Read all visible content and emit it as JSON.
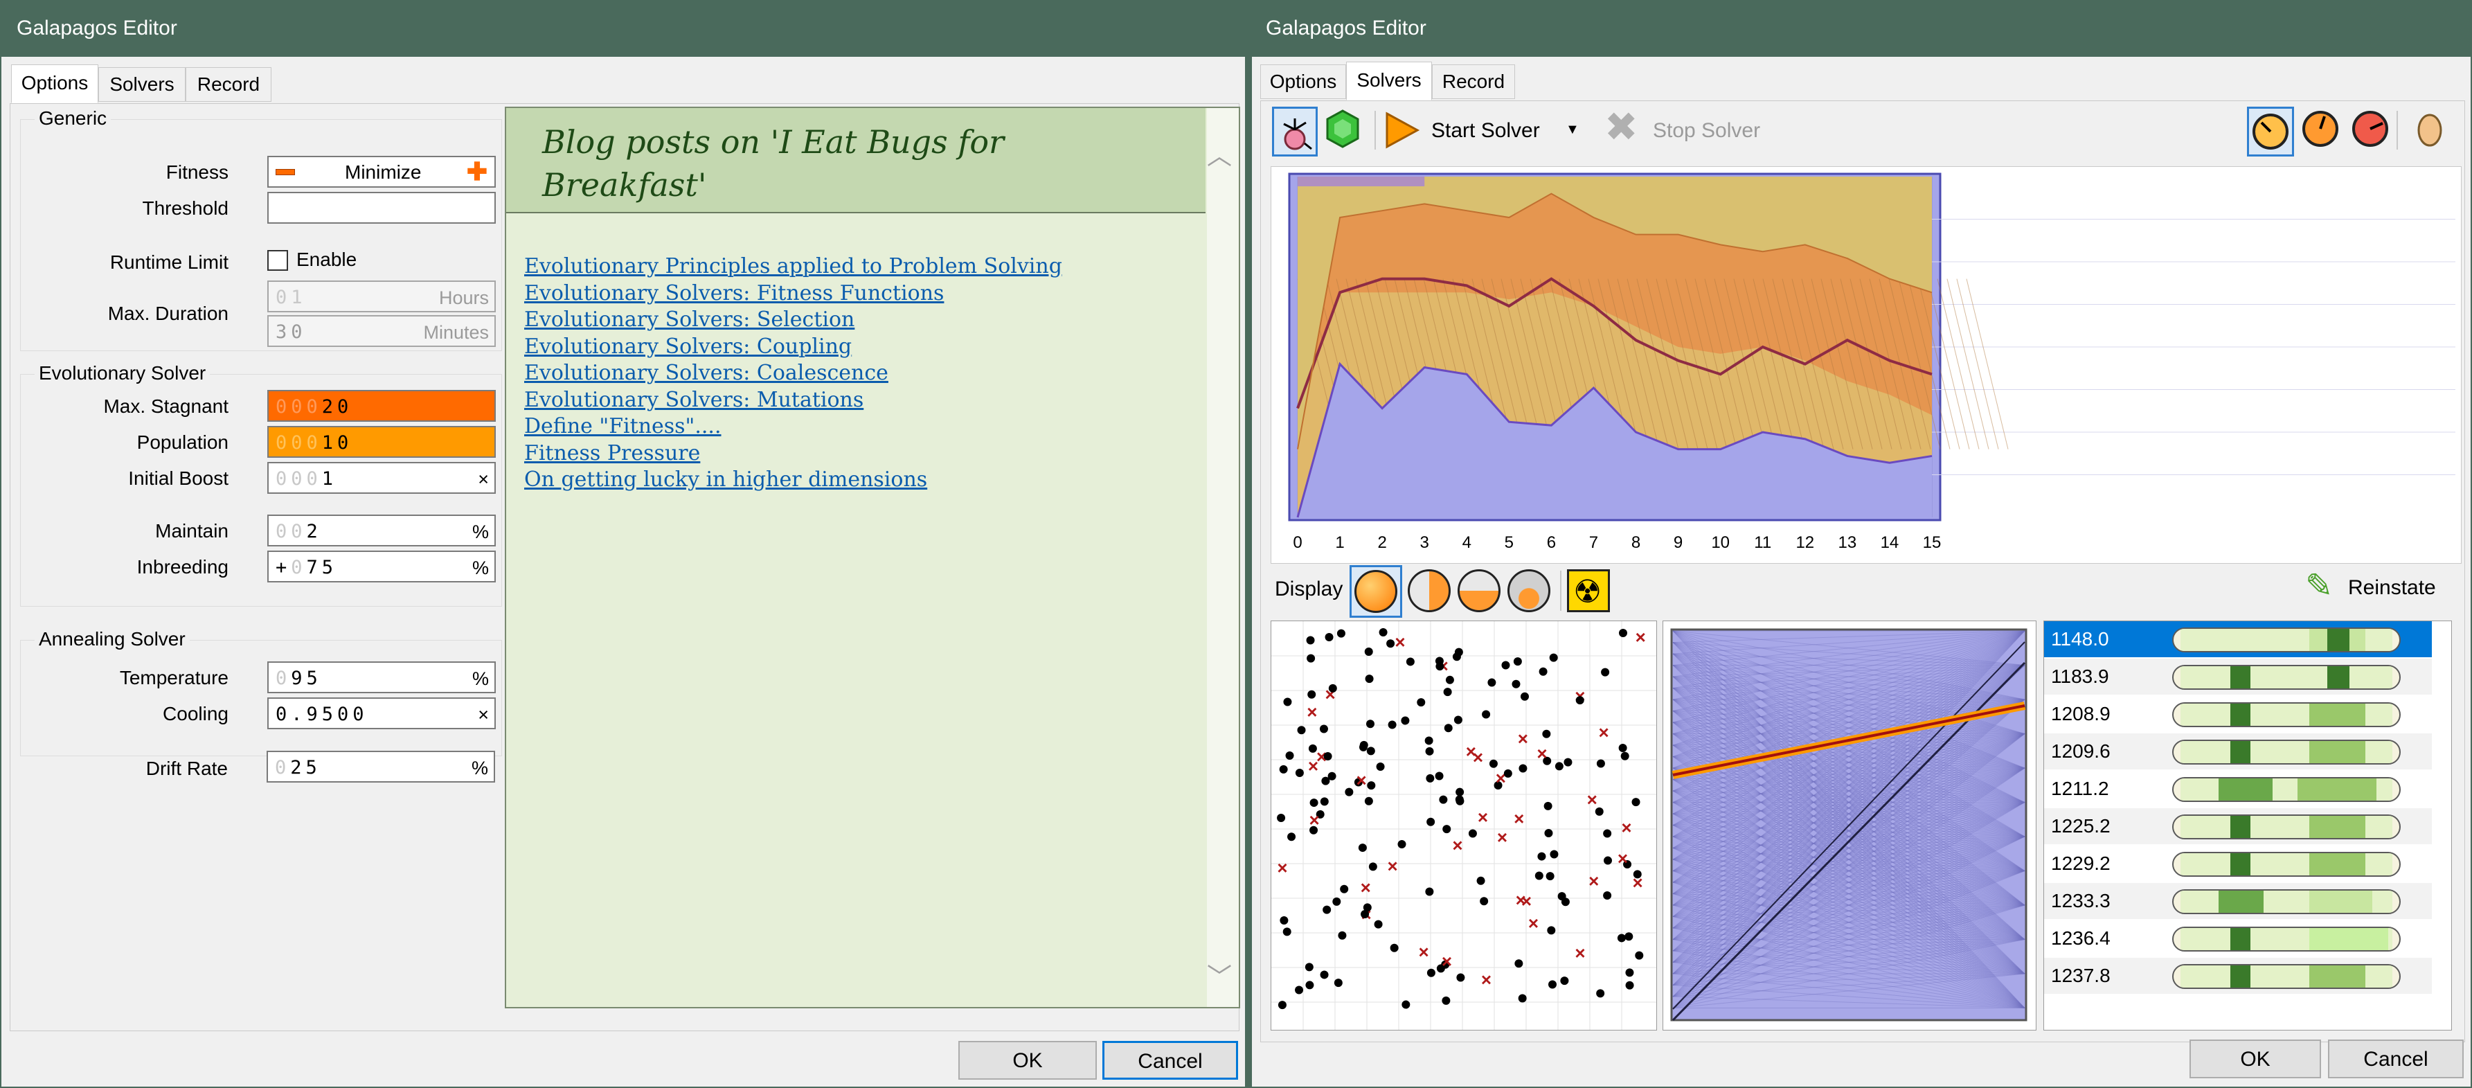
{
  "left": {
    "title": "Galapagos Editor",
    "tabs": [
      "Options",
      "Solvers",
      "Record"
    ],
    "active_tab": "Options",
    "generic": {
      "title": "Generic",
      "fitness_label": "Fitness",
      "fitness_value": "Minimize",
      "threshold_label": "Threshold",
      "runtime_label": "Runtime Limit",
      "enable_label": "Enable",
      "maxdur_label": "Max. Duration",
      "hours_digits": "01",
      "hours_unit": "Hours",
      "minutes_digits": "30",
      "minutes_unit": "Minutes"
    },
    "evo": {
      "title": "Evolutionary Solver",
      "stagnant_label": "Max. Stagnant",
      "stagnant_ghost": "000",
      "stagnant_digits": "20",
      "population_label": "Population",
      "population_ghost": "000",
      "population_digits": "10",
      "boost_label": "Initial Boost",
      "boost_ghost": "000",
      "boost_digits": "1",
      "boost_unit": "×",
      "maintain_label": "Maintain",
      "maintain_ghost": "00",
      "maintain_digits": "2",
      "maintain_unit": "%",
      "inbreeding_label": "Inbreeding",
      "inbreeding_prefix": "+",
      "inbreeding_ghost": "0",
      "inbreeding_digits": "75",
      "inbreeding_unit": "%"
    },
    "anneal": {
      "title": "Annealing Solver",
      "temp_label": "Temperature",
      "temp_ghost": "0",
      "temp_digits": "95",
      "temp_unit": "%",
      "cooling_label": "Cooling",
      "cooling_digits": "0.9500",
      "cooling_unit": "×"
    },
    "drift_label": "Drift Rate",
    "drift_ghost": "0",
    "drift_digits": "25",
    "drift_unit": "%",
    "blog": {
      "title": "Blog posts on 'I Eat Bugs for Breakfast'",
      "links": [
        "Evolutionary Principles applied to Problem Solving",
        "Evolutionary Solvers: Fitness Functions",
        "Evolutionary Solvers: Selection",
        "Evolutionary Solvers: Coupling",
        "Evolutionary Solvers: Coalescence",
        "Evolutionary Solvers: Mutations",
        "Define \"Fitness\"....",
        "Fitness Pressure",
        "On getting lucky in higher dimensions"
      ]
    },
    "ok": "OK",
    "cancel": "Cancel"
  },
  "right": {
    "title": "Galapagos Editor",
    "tabs": [
      "Options",
      "Solvers",
      "Record"
    ],
    "active_tab": "Solvers",
    "start_solver": "Start Solver",
    "stop_solver": "Stop Solver",
    "display_label": "Display",
    "reinstate_label": "Reinstate",
    "ok": "OK",
    "cancel": "Cancel",
    "ranks": [
      {
        "value": "1148.0",
        "selected": true
      },
      {
        "value": "1183.9"
      },
      {
        "value": "1208.9"
      },
      {
        "value": "1209.6"
      },
      {
        "value": "1211.2"
      },
      {
        "value": "1225.2"
      },
      {
        "value": "1229.2"
      },
      {
        "value": "1233.3"
      },
      {
        "value": "1236.4"
      },
      {
        "value": "1237.8"
      }
    ]
  },
  "chart_data": {
    "type": "area",
    "x": [
      0,
      1,
      2,
      3,
      4,
      5,
      6,
      7,
      8,
      9,
      10,
      11,
      12,
      13,
      14,
      15
    ],
    "x_tick_labels": [
      "0",
      "1",
      "2",
      "3",
      "4",
      "5",
      "6",
      "7",
      "8",
      "9",
      "10",
      "11",
      "12",
      "13",
      "14",
      "15"
    ],
    "ylim": [
      0,
      1
    ],
    "series": [
      {
        "values": [
          1.0,
          1.0,
          1.0,
          1.0,
          1.0,
          1.0,
          1.0,
          1.0,
          1.0,
          1.0,
          1.0,
          1.0,
          1.0,
          1.0,
          1.0,
          1.0
        ]
      },
      {
        "values": [
          0.2,
          0.88,
          0.9,
          0.92,
          0.9,
          0.88,
          0.95,
          0.88,
          0.83,
          0.83,
          0.8,
          0.78,
          0.8,
          0.76,
          0.7,
          0.66
        ]
      },
      {
        "values": [
          0.3,
          0.66,
          0.66,
          0.66,
          0.66,
          0.64,
          0.66,
          0.62,
          0.56,
          0.5,
          0.48,
          0.5,
          0.46,
          0.4,
          0.36,
          0.3
        ]
      },
      {
        "values": [
          0.32,
          0.66,
          0.7,
          0.7,
          0.68,
          0.62,
          0.7,
          0.62,
          0.52,
          0.46,
          0.42,
          0.5,
          0.45,
          0.52,
          0.46,
          0.42
        ]
      },
      {
        "values": [
          0.0,
          0.45,
          0.32,
          0.44,
          0.42,
          0.28,
          0.27,
          0.38,
          0.25,
          0.2,
          0.2,
          0.25,
          0.23,
          0.18,
          0.16,
          0.18
        ]
      },
      {
        "values": [
          0.0,
          0.28,
          0.2,
          0.24,
          0.22,
          0.16,
          0.18,
          0.22,
          0.13,
          0.12,
          0.1,
          0.12,
          0.09,
          0.08,
          0.07,
          0.08
        ]
      }
    ]
  },
  "colors": {
    "title_bar": "#4a6a5c",
    "orange": "#ff6a00",
    "orange_light": "#ff9a00",
    "plot_blue": "#a5a5ea",
    "plot_tan": "#d9c070",
    "plot_orange": "#e59650",
    "fitness_line": "#8e2b44",
    "blog_bg": "#e6efd8",
    "blog_header": "#c4d8b0",
    "selection": "#0078d7"
  }
}
